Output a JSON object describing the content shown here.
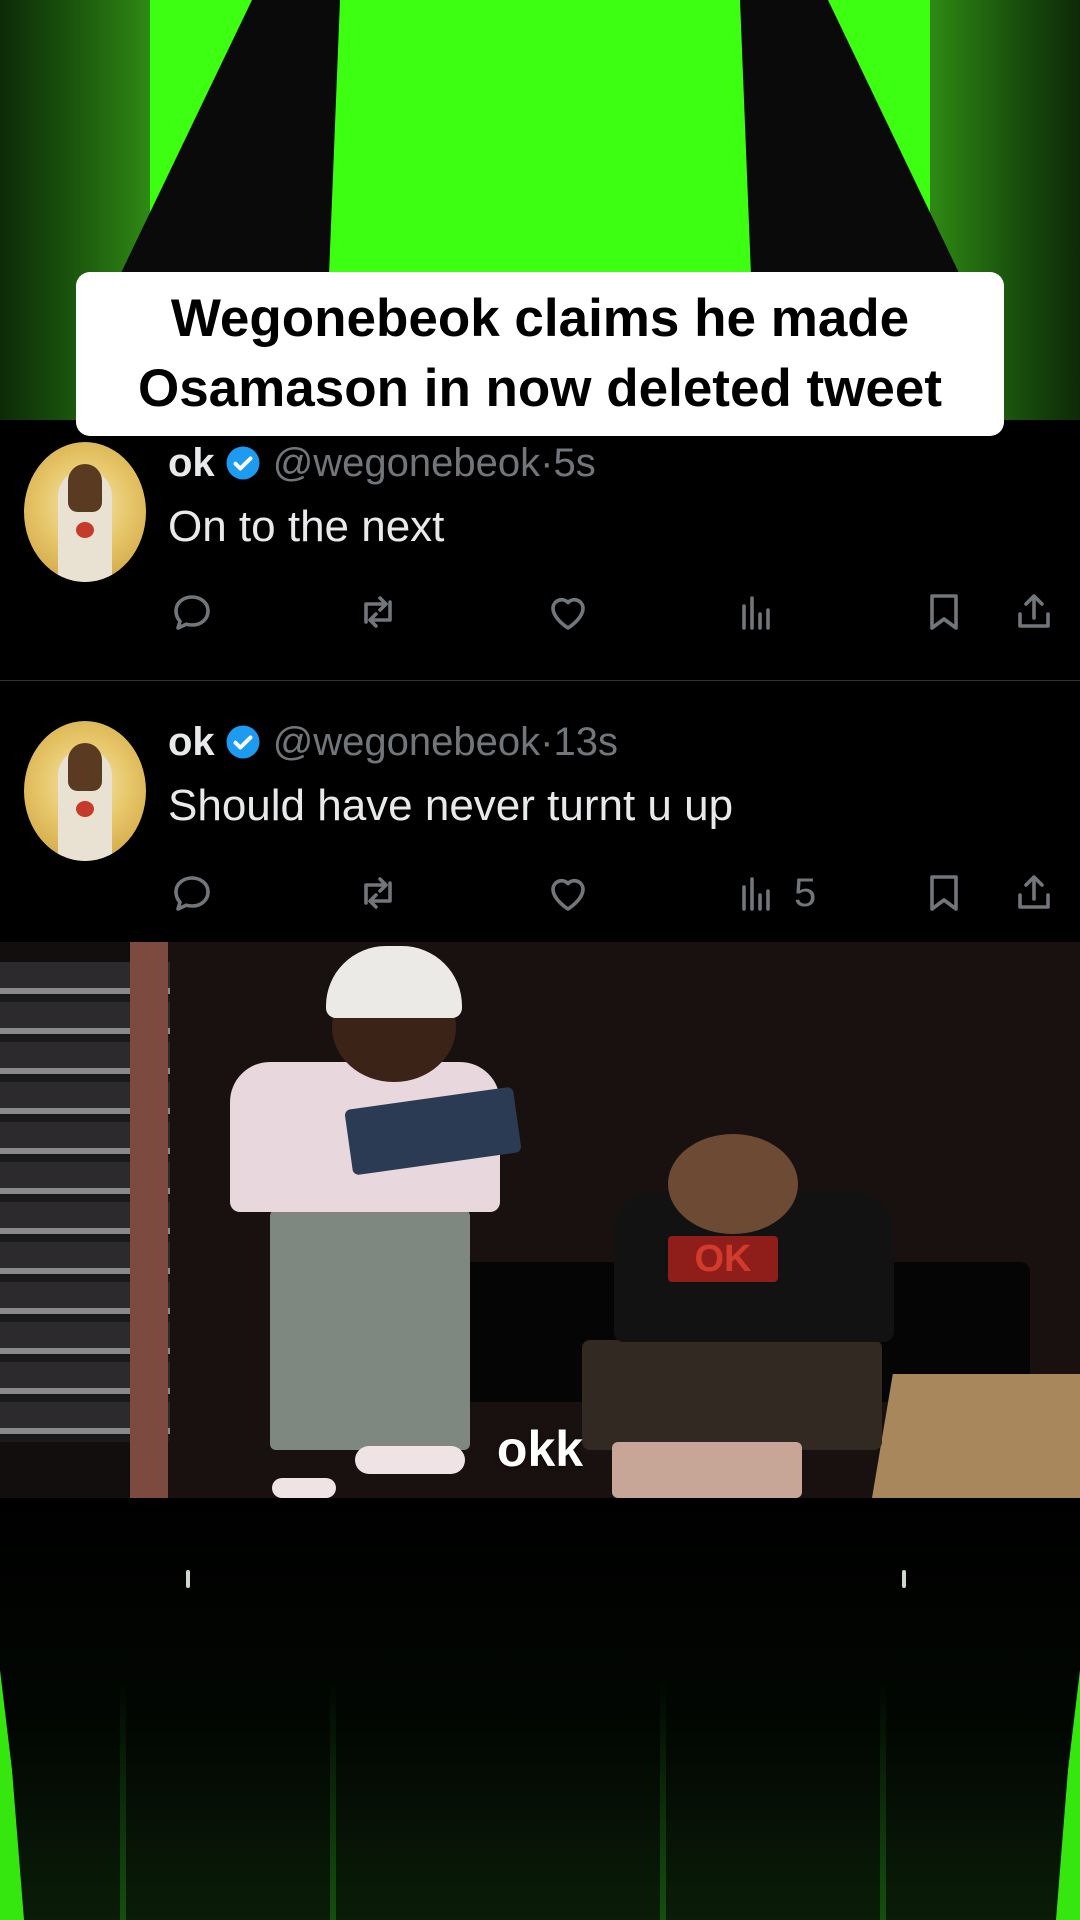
{
  "caption": {
    "line1": "Wegonebeok claims he made",
    "line2": "Osamason in now deleted tweet"
  },
  "tweets": [
    {
      "name": "ok",
      "handle": "@wegonebeok",
      "sep": "·",
      "time": "5s",
      "text": "On to the next",
      "views": ""
    },
    {
      "name": "ok",
      "handle": "@wegonebeok",
      "sep": "·",
      "time": "13s",
      "text": "Should have never turnt u up",
      "views": "5"
    }
  ],
  "video": {
    "subtitle": "okk",
    "jersey_text": "OK"
  },
  "colors": {
    "green_screen": "#3dff12",
    "verified": "#1d9bf0",
    "muted_text": "#71767b",
    "primary_text": "#e7e9ea"
  },
  "icons": [
    "reply-icon",
    "retweet-icon",
    "like-icon",
    "views-icon",
    "bookmark-icon",
    "share-icon",
    "verified-badge-icon"
  ]
}
